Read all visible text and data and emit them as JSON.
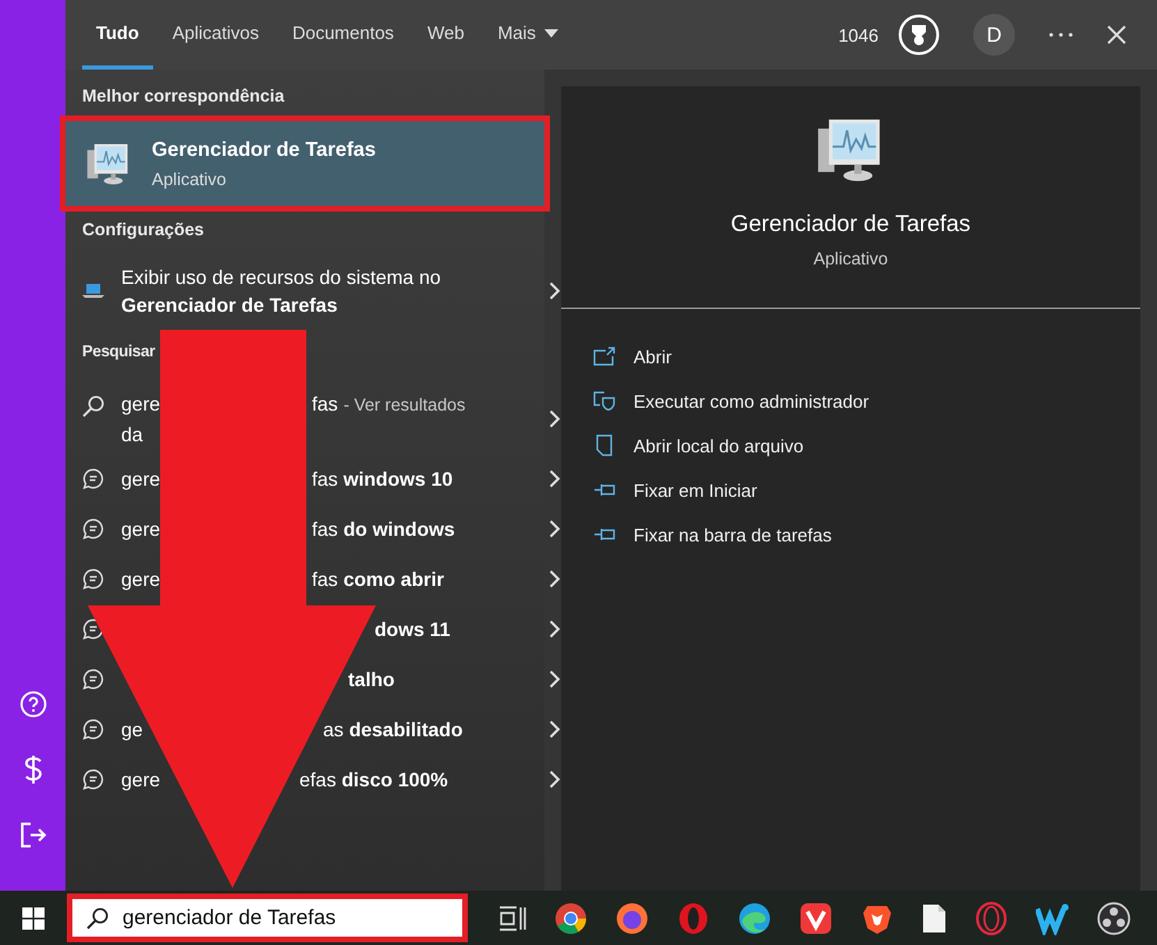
{
  "tabs": [
    {
      "label": "Tudo",
      "selected": true,
      "dropdown": false
    },
    {
      "label": "Aplicativos",
      "selected": false,
      "dropdown": false
    },
    {
      "label": "Documentos",
      "selected": false,
      "dropdown": false
    },
    {
      "label": "Web",
      "selected": false,
      "dropdown": false
    },
    {
      "label": "Mais",
      "selected": false,
      "dropdown": true
    }
  ],
  "header_right": {
    "points": "1046",
    "avatar": "D"
  },
  "best_match": {
    "heading": "Melhor correspondência",
    "title": "Gerenciador de Tarefas",
    "subtitle": "Aplicativo",
    "selected": true
  },
  "settings": {
    "heading": "Configurações",
    "items": [
      {
        "text": "Exibir uso de recursos do sistema no **Gerenciador de Tarefas**"
      }
    ]
  },
  "search_web": {
    "heading": "Pesquisar",
    "results": [
      {
        "kind": "web",
        "left": [
          "gere",
          "da"
        ],
        "right": "fas",
        "note": "- Ver resultados"
      },
      {
        "kind": "suggestion",
        "left": [
          "gere"
        ],
        "right": "fas **windows 10**"
      },
      {
        "kind": "suggestion",
        "left": [
          "gere"
        ],
        "right": "fas **do windows**"
      },
      {
        "kind": "suggestion",
        "left": [
          "gere"
        ],
        "right": "fas **como abrir**"
      },
      {
        "kind": "suggestion",
        "right": "**dows 11**"
      },
      {
        "kind": "suggestion",
        "right": "**talho**"
      },
      {
        "kind": "suggestion",
        "left": [
          "ge"
        ],
        "right": "as **desabilitado**"
      },
      {
        "kind": "suggestion",
        "left": [
          "gere"
        ],
        "right": "efas **disco 100%**"
      }
    ]
  },
  "preview": {
    "title": "Gerenciador de Tarefas",
    "subtitle": "Aplicativo",
    "actions": [
      {
        "kind": "open",
        "label": "Abrir"
      },
      {
        "kind": "admin",
        "label": "Executar como administrador"
      },
      {
        "kind": "folder",
        "label": "Abrir local do arquivo"
      },
      {
        "kind": "pin",
        "label": "Fixar em Iniciar"
      },
      {
        "kind": "pin",
        "label": "Fixar na barra de tarefas"
      }
    ]
  },
  "taskbar": {
    "search": {
      "value": "gerenciador de Tarefas"
    },
    "apps": [
      {
        "kind": "taskview"
      },
      {
        "kind": "chrome"
      },
      {
        "kind": "firefox"
      },
      {
        "kind": "opera"
      },
      {
        "kind": "edge"
      },
      {
        "kind": "vivaldi"
      },
      {
        "kind": "brave"
      },
      {
        "kind": "file"
      },
      {
        "kind": "operagx"
      },
      {
        "kind": "wave"
      },
      {
        "kind": "obs"
      }
    ]
  }
}
